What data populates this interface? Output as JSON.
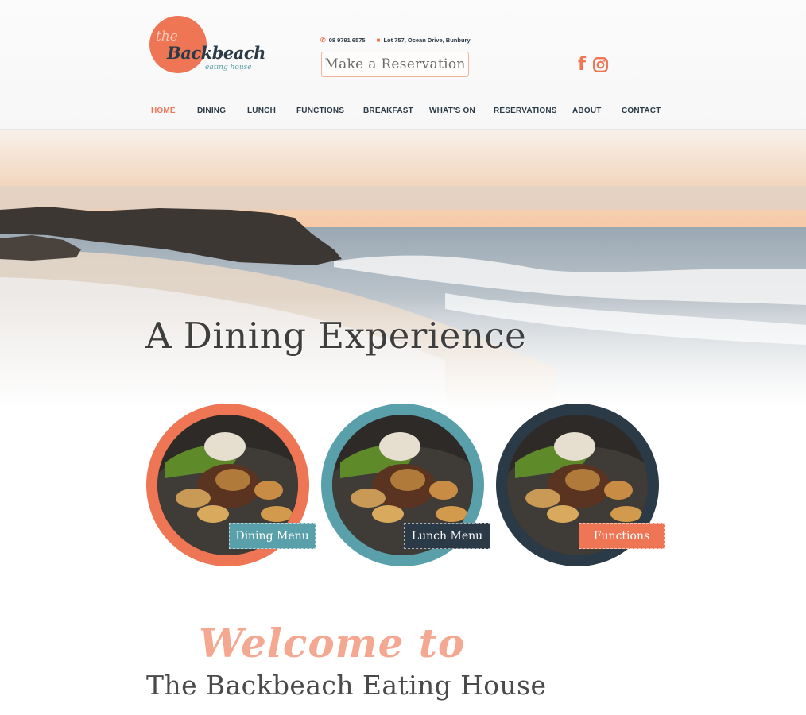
{
  "logo": {
    "prefix": "the",
    "name": "Backbeach",
    "sub": "eating house"
  },
  "contact": {
    "phone": "08 9791 6575",
    "address": "Lot 757, Ocean Drive, Bunbury"
  },
  "header": {
    "reserve_label": "Make a Reservation"
  },
  "social": {
    "facebook_glyph": "f",
    "icons": [
      "facebook-icon",
      "instagram-icon"
    ]
  },
  "nav": {
    "items": [
      {
        "label": "HOME",
        "active": true
      },
      {
        "label": "DINING"
      },
      {
        "label": "LUNCH"
      },
      {
        "label": "FUNCTIONS"
      },
      {
        "label": "BREAKFAST"
      },
      {
        "label": "WHAT'S ON"
      },
      {
        "label": "RESERVATIONS"
      },
      {
        "label": "ABOUT"
      },
      {
        "label": "CONTACT"
      }
    ]
  },
  "hero": {
    "title": "A Dining Experience"
  },
  "cards": [
    {
      "label": "Dining Menu",
      "ring_color": "#ee7654",
      "button_color": "#5aa0ab"
    },
    {
      "label": "Lunch Menu",
      "ring_color": "#5aa0ab",
      "button_color": "#2b3a47"
    },
    {
      "label": "Functions",
      "ring_color": "#2b3a47",
      "button_color": "#ee7654"
    }
  ],
  "welcome": {
    "script": "Welcome to",
    "title": "The Backbeach Eating House"
  },
  "colors": {
    "coral": "#ee7654",
    "teal": "#5aa0ab",
    "navy": "#2b3a47"
  }
}
